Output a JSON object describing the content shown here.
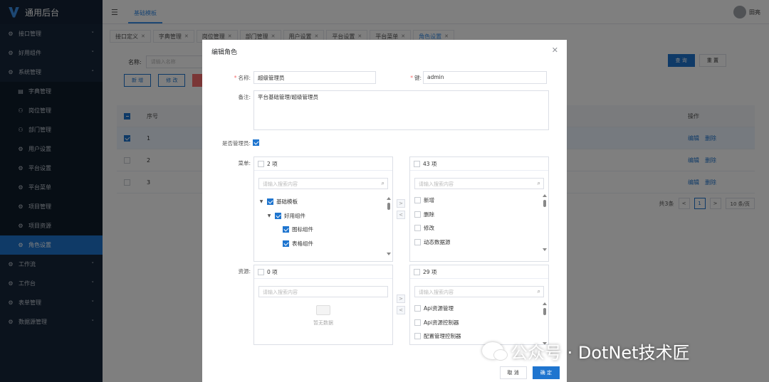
{
  "app": {
    "title": "通用后台"
  },
  "sidebar": {
    "items": [
      {
        "label": "接口管理",
        "icon": "api-icon",
        "glyph": "⚙",
        "level": 0,
        "expanded": false
      },
      {
        "label": "好用组件",
        "icon": "component-icon",
        "glyph": "⚙",
        "level": 0,
        "expanded": false
      },
      {
        "label": "系统管理",
        "icon": "gear-icon",
        "glyph": "⚙",
        "level": 0,
        "expanded": true
      },
      {
        "label": "字典管理",
        "icon": "dict-icon",
        "glyph": "▤",
        "level": 1
      },
      {
        "label": "岗位管理",
        "icon": "post-icon",
        "glyph": "⚇",
        "level": 1
      },
      {
        "label": "部门管理",
        "icon": "dept-icon",
        "glyph": "⚇",
        "level": 1
      },
      {
        "label": "用户设置",
        "icon": "user-icon",
        "glyph": "⚙",
        "level": 1
      },
      {
        "label": "平台设置",
        "icon": "platform-icon",
        "glyph": "⚙",
        "level": 1
      },
      {
        "label": "平台菜单",
        "icon": "menu-icon",
        "glyph": "⚙",
        "level": 1
      },
      {
        "label": "项目管理",
        "icon": "project-icon",
        "glyph": "⚙",
        "level": 1
      },
      {
        "label": "项目资源",
        "icon": "resource-icon",
        "glyph": "⚙",
        "level": 1
      },
      {
        "label": "角色设置",
        "icon": "role-icon",
        "glyph": "⚙",
        "level": 1,
        "active": true
      },
      {
        "label": "工作流",
        "icon": "workflow-icon",
        "glyph": "⚙",
        "level": 0,
        "expanded": false
      },
      {
        "label": "工作台",
        "icon": "workbench-icon",
        "glyph": "⚙",
        "level": 0,
        "expanded": false
      },
      {
        "label": "表单管理",
        "icon": "form-icon",
        "glyph": "⚙",
        "level": 0,
        "expanded": false
      },
      {
        "label": "数据源管理",
        "icon": "datasource-icon",
        "glyph": "⚙",
        "level": 0,
        "expanded": false
      }
    ]
  },
  "header": {
    "breadcrumb": "基础模板",
    "user_name": "田亮"
  },
  "tabs": [
    {
      "label": "接口定义",
      "active": false
    },
    {
      "label": "字典管理",
      "active": false
    },
    {
      "label": "岗位管理",
      "active": false
    },
    {
      "label": "部门管理",
      "active": false
    },
    {
      "label": "用户设置",
      "active": false
    },
    {
      "label": "平台设置",
      "active": false
    },
    {
      "label": "平台菜单",
      "active": false
    },
    {
      "label": "角色设置",
      "active": true
    }
  ],
  "page": {
    "search_label": "名称:",
    "search_placeholder": "请输入名称",
    "btn_add": "新 增",
    "btn_edit": "修 改",
    "btn_query": "查 询",
    "btn_reset": "重 置",
    "table": {
      "headers": {
        "index": "序号",
        "ops": "操作"
      },
      "rows": [
        {
          "index": "1",
          "selected": true,
          "edit": "编辑",
          "del": "删除"
        },
        {
          "index": "2",
          "selected": false,
          "edit": "编辑",
          "del": "删除"
        },
        {
          "index": "3",
          "selected": false,
          "edit": "编辑",
          "del": "删除"
        }
      ]
    },
    "pager": {
      "total": "共3条",
      "prev": "<",
      "current": "1",
      "next": ">",
      "size": "10 条/页"
    }
  },
  "dialog": {
    "title": "编辑角色",
    "name_label": "名称:",
    "name_value": "超级管理员",
    "key_label": "键:",
    "key_value": "admin",
    "remark_label": "备注:",
    "remark_value": "平台基础管理/超级管理员",
    "is_admin_label": "是否管理员:",
    "is_admin": true,
    "menu_label": "菜单:",
    "resource_label": "资源:",
    "search_placeholder": "请输入搜索内容",
    "menu_left": {
      "count": "2 项",
      "tree": [
        {
          "label": "基础模板",
          "depth": 0,
          "arrow": true,
          "checked": true
        },
        {
          "label": "好用组件",
          "depth": 1,
          "arrow": true,
          "checked": true
        },
        {
          "label": "图标组件",
          "depth": 2,
          "arrow": false,
          "checked": true
        },
        {
          "label": "表格组件",
          "depth": 2,
          "arrow": false,
          "checked": true
        }
      ]
    },
    "menu_right": {
      "count": "43 项",
      "items": [
        "新增",
        "删除",
        "修改",
        "动态数据源"
      ]
    },
    "res_left": {
      "count": "0 项",
      "empty_text": "暂无数据"
    },
    "res_right": {
      "count": "29 项",
      "items": [
        "Api资源管理",
        "Api资源控制器",
        "配置管理控制器"
      ]
    },
    "transfer_right": ">",
    "transfer_left": "<",
    "cancel": "取 消",
    "confirm": "确 定"
  },
  "watermark": {
    "text": "公众号 · DotNet技术匠"
  },
  "colors": {
    "primary": "#1f75cf",
    "sidebar": "#17273b",
    "danger": "#f56c6c"
  }
}
